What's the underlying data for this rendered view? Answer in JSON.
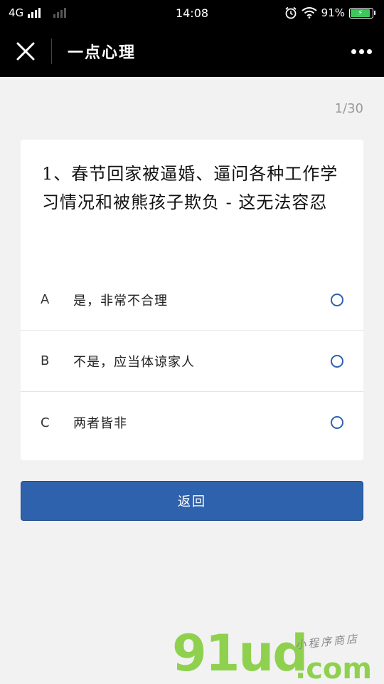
{
  "status_bar": {
    "network": "4G",
    "time": "14:08",
    "battery_percent": "91%",
    "battery_level": 0.91,
    "battery_color": "#3cc85a"
  },
  "nav_bar": {
    "title": "一点心理",
    "close_icon": "close-icon",
    "more_icon": "more-dots-icon"
  },
  "progress": "1/30",
  "question": {
    "text": "1、春节回家被逼婚、逼问各种工作学习情况和被熊孩子欺负 - 这无法容忍",
    "options": [
      {
        "letter": "A",
        "label": "是，非常不合理"
      },
      {
        "letter": "B",
        "label": "不是，应当体谅家人"
      },
      {
        "letter": "C",
        "label": "两者皆非"
      }
    ]
  },
  "back_button": {
    "label": "返回"
  },
  "colors": {
    "accent": "#2e62ac",
    "background": "#f2f2f2"
  },
  "watermark": {
    "logo": "91ud",
    "domain": ".com",
    "subtitle": "小程序商店"
  }
}
